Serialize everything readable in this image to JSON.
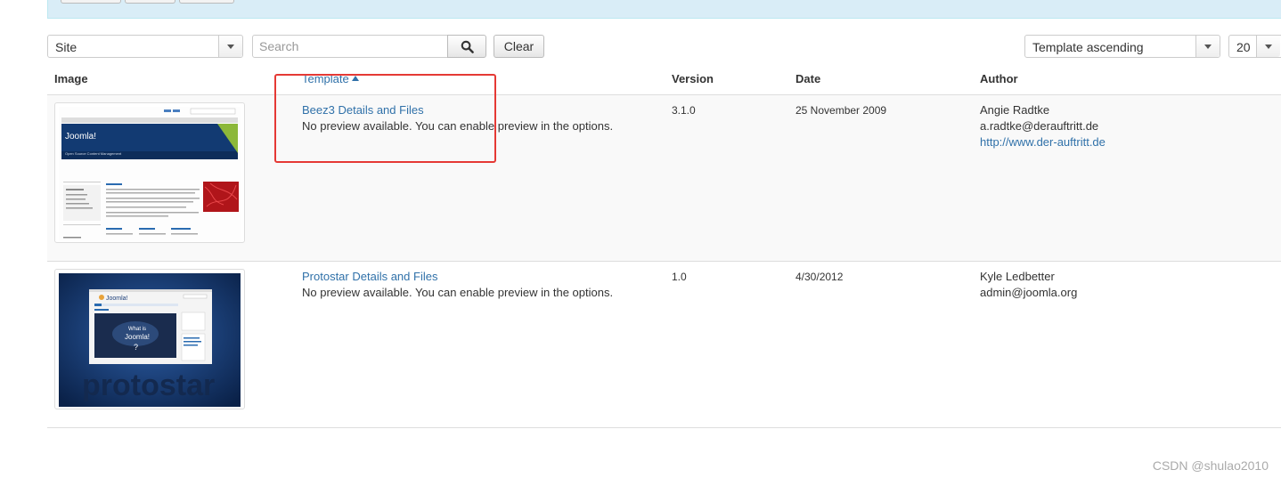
{
  "filters": {
    "client_select": "Site",
    "search_placeholder": "Search",
    "clear_label": "Clear",
    "ordering_select": "Template ascending",
    "limit_select": "20"
  },
  "table": {
    "headers": {
      "image": "Image",
      "template": "Template",
      "version": "Version",
      "date": "Date",
      "author": "Author"
    },
    "rows": [
      {
        "template_link": "Beez3 Details and Files",
        "preview_note": "No preview available. You can enable preview in the options.",
        "version": "3.1.0",
        "date": "25 November 2009",
        "author_name": "Angie Radtke",
        "author_email": "a.radtke@derauftritt.de",
        "author_url": "http://www.der-auftritt.de",
        "thumb": {
          "brand": "Joomla!",
          "subtitle": "Open Source Content Management"
        }
      },
      {
        "template_link": "Protostar Details and Files",
        "preview_note": "No preview available. You can enable preview in the options.",
        "version": "1.0",
        "date": "4/30/2012",
        "author_name": "Kyle Ledbetter",
        "author_email": "admin@joomla.org",
        "thumb": {
          "brand": "Joomla!",
          "big_word": "protostar"
        }
      }
    ]
  },
  "watermark": "CSDN @shulao2010",
  "colors": {
    "link": "#3071a9",
    "highlight_box": "#e53935",
    "notice_bg": "#d9edf7"
  },
  "icons": {
    "search": "search-icon",
    "sort": "sort-ascending-icon",
    "dropdown": "chevron-down-icon"
  }
}
